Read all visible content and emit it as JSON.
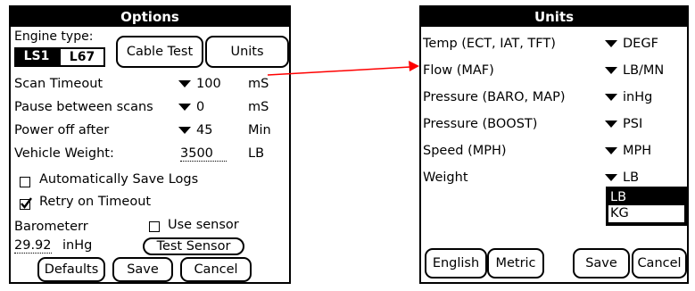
{
  "options": {
    "title": "Options",
    "engine_type_label": "Engine type:",
    "engine_types": [
      "LS1",
      "L67"
    ],
    "cable_test_label": "Cable Test",
    "units_label": "Units",
    "scan_timeout": {
      "label": "Scan Timeout",
      "value": "100",
      "unit": "mS"
    },
    "pause_between_scans": {
      "label": "Pause between scans",
      "value": "0",
      "unit": "mS"
    },
    "power_off_after": {
      "label": "Power off after",
      "value": "45",
      "unit": "Min"
    },
    "vehicle_weight": {
      "label": "Vehicle Weight:",
      "value": "3500",
      "unit": "LB"
    },
    "auto_save_logs_label": "Automatically Save Logs",
    "retry_on_timeout_label": "Retry on Timeout",
    "barometer_label": "Barometerr",
    "use_sensor_label": "Use sensor",
    "barometer_value": "29.92",
    "barometer_unit": "inHg",
    "test_sensor_label": "Test Sensor",
    "defaults_label": "Defaults",
    "save_label": "Save",
    "cancel_label": "Cancel"
  },
  "units": {
    "title": "Units",
    "rows": [
      {
        "label": "Temp (ECT, IAT, TFT)",
        "value": "DEGF"
      },
      {
        "label": "Flow (MAF)",
        "value": "LB/MN"
      },
      {
        "label": "Pressure (BARO, MAP)",
        "value": "inHg"
      },
      {
        "label": "Pressure (BOOST)",
        "value": "PSI"
      },
      {
        "label": "Speed (MPH)",
        "value": "MPH"
      },
      {
        "label": "Weight",
        "value": "LB"
      }
    ],
    "weight_options": [
      "LB",
      "KG"
    ],
    "english_label": "English",
    "metric_label": "Metric",
    "save_label": "Save",
    "cancel_label": "Cancel"
  },
  "colors": {
    "arrow": "#ff0000"
  }
}
